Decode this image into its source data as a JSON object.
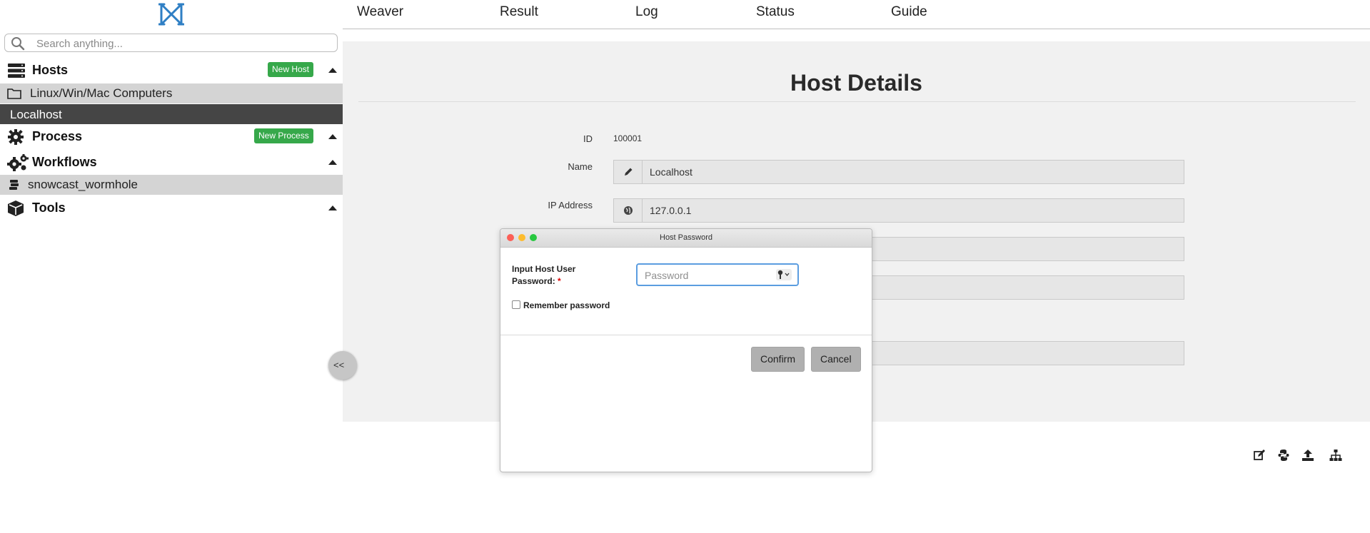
{
  "search": {
    "placeholder": "Search anything..."
  },
  "sidebar": {
    "hosts": {
      "title": "Hosts",
      "new_button": "New Host",
      "folder": "Linux/Win/Mac Computers",
      "selected_item": "Localhost"
    },
    "process": {
      "title": "Process",
      "new_button": "New Process"
    },
    "workflows": {
      "title": "Workflows",
      "item": "snowcast_wormhole"
    },
    "tools": {
      "title": "Tools"
    },
    "collapse_label": "<<"
  },
  "tabs": [
    "Weaver",
    "Result",
    "Log",
    "Status",
    "Guide"
  ],
  "main": {
    "title": "Host Details",
    "fields": {
      "id_label": "ID",
      "id_value": "100001",
      "name_label": "Name",
      "name_value": "Localhost",
      "ip_label": "IP Address",
      "ip_value": "127.0.0.1"
    }
  },
  "dialog": {
    "title": "Host Password",
    "label_line1": "Input Host User",
    "label_line2": "Password:",
    "required_mark": "*",
    "password_placeholder": "Password",
    "remember_label": "Remember password",
    "confirm": "Confirm",
    "cancel": "Cancel"
  },
  "colors": {
    "accent_green": "#36a84a",
    "logo_blue": "#2f7fc4",
    "selected_dark": "#454545",
    "focus_blue": "#5b9de0"
  },
  "icons": [
    "app-logo-icon",
    "search-icon",
    "hosts-server-icon",
    "folder-icon",
    "gear-icon",
    "gears-icon",
    "workflow-icon",
    "cube-icon",
    "pencil-icon",
    "globe-icon",
    "key-icon",
    "edit-icon",
    "python-icon",
    "upload-icon",
    "sitemap-icon"
  ]
}
